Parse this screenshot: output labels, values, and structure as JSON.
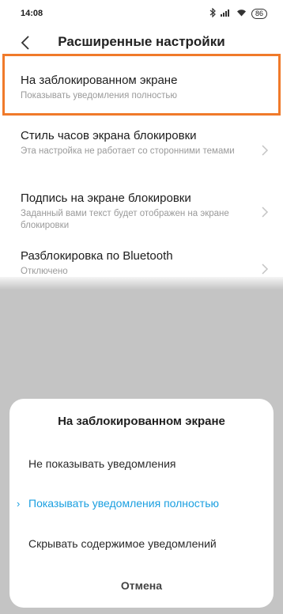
{
  "status": {
    "time": "14:08",
    "battery": "86"
  },
  "header": {
    "title": "Расширенные настройки"
  },
  "settings": [
    {
      "title": "На заблокированном экране",
      "subtitle": "Показывать уведомления полностью"
    },
    {
      "title": "Стиль часов экрана блокировки",
      "subtitle": "Эта настройка не работает со сторонними темами"
    },
    {
      "title": "Подпись на экране блокировки",
      "subtitle": "Заданный вами текст будет отображен на экране блокировки"
    },
    {
      "title": "Разблокировка по Bluetooth",
      "subtitle": "Отключено"
    }
  ],
  "dialog": {
    "title": "На заблокированном экране",
    "options": [
      {
        "label": "Не показывать уведомления",
        "selected": false
      },
      {
        "label": "Показывать уведомления полностью",
        "selected": true
      },
      {
        "label": "Скрывать содержимое уведомлений",
        "selected": false
      }
    ],
    "cancel_label": "Отмена"
  },
  "colors": {
    "accent": "#1a9fe0",
    "highlight_border": "#f07a2a"
  }
}
